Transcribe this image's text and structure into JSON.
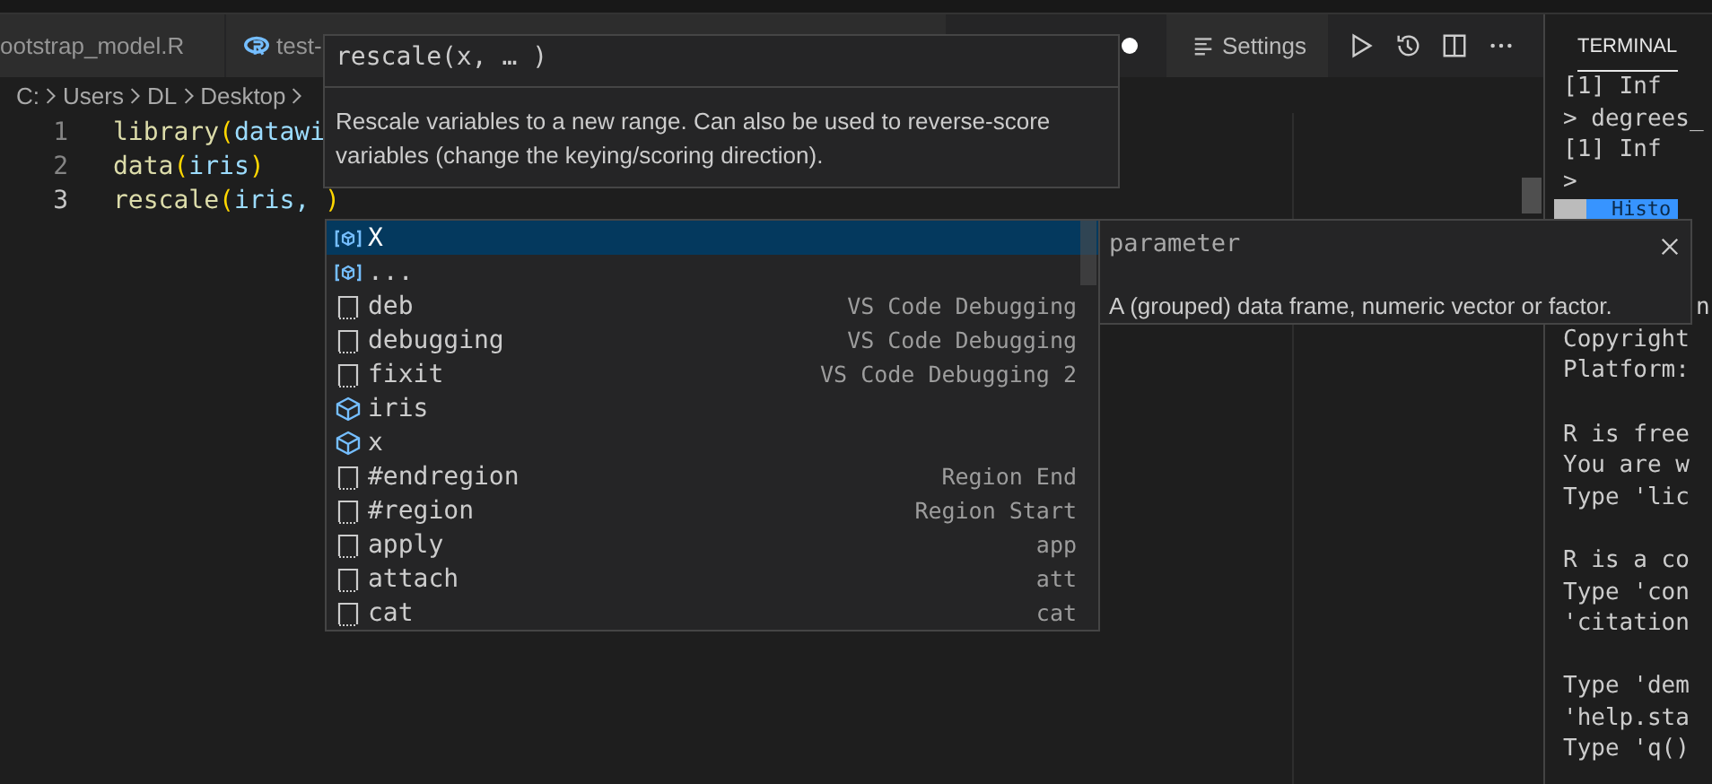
{
  "tabs": [
    {
      "label": "ootstrap_model.R",
      "kind": "file",
      "selected": false,
      "dirty": false
    },
    {
      "label": "test-",
      "kind": "rfile",
      "selected": false,
      "dirty": true
    },
    {
      "label": "Settings",
      "kind": "settings",
      "selected": true,
      "dirty": false
    }
  ],
  "breadcrumbs": [
    "C:",
    "Users",
    "DL",
    "Desktop"
  ],
  "code_lines": [
    {
      "number": "1",
      "tokens": [
        {
          "text": "library",
          "kind": "fn"
        },
        {
          "text": "(",
          "kind": "paren"
        },
        {
          "text": "datawi",
          "kind": "id"
        }
      ]
    },
    {
      "number": "2",
      "tokens": [
        {
          "text": "data",
          "kind": "fn"
        },
        {
          "text": "(",
          "kind": "paren"
        },
        {
          "text": "iris",
          "kind": "id"
        },
        {
          "text": ")",
          "kind": "paren"
        }
      ]
    },
    {
      "number": "3",
      "tokens": [
        {
          "text": "rescale",
          "kind": "fn"
        },
        {
          "text": "(",
          "kind": "paren"
        },
        {
          "text": "iris, ",
          "kind": "id"
        },
        {
          "text": ")",
          "kind": "paren"
        }
      ]
    }
  ],
  "signature_hover": {
    "signature": "rescale(x, … )",
    "description": "Rescale variables to a new range. Can also be used to reverse-score variables (change the keying/scoring direction)."
  },
  "suggestions": [
    {
      "label": "X",
      "kind": "variable",
      "selected": true
    },
    {
      "label": "...",
      "kind": "variable",
      "selected": false
    },
    {
      "label": "deb",
      "detail": "VS Code Debugging",
      "kind": "snippet",
      "selected": false
    },
    {
      "label": "debugging",
      "detail": "VS Code Debugging",
      "kind": "snippet",
      "selected": false
    },
    {
      "label": "fixit",
      "detail": "VS Code Debugging 2",
      "kind": "snippet",
      "selected": false
    },
    {
      "label": "iris",
      "kind": "field",
      "selected": false
    },
    {
      "label": "x",
      "kind": "field",
      "selected": false
    },
    {
      "label": "#endregion",
      "detail": "Region End",
      "kind": "snippet",
      "selected": false
    },
    {
      "label": "#region",
      "detail": "Region Start",
      "kind": "snippet",
      "selected": false
    },
    {
      "label": "apply",
      "detail": "app",
      "kind": "snippet",
      "selected": false
    },
    {
      "label": "attach",
      "detail": "att",
      "kind": "snippet",
      "selected": false
    },
    {
      "label": "cat",
      "detail": "cat",
      "kind": "snippet",
      "selected": false
    }
  ],
  "suggestion_details": {
    "title": "parameter",
    "description": "A (grouped) data frame, numeric vector or factor."
  },
  "terminal": {
    "tab": "TERMINAL",
    "lines": [
      {
        "text": "[1] Inf",
        "kind": "plain"
      },
      {
        "text": "> degrees_",
        "kind": "plain"
      },
      {
        "text": "[1] Inf",
        "kind": "plain"
      },
      {
        "text": ">",
        "kind": "plain"
      },
      {
        "text": "Histo",
        "kind": "badge"
      },
      {
        "kind": "gap"
      },
      {
        "kind": "gap"
      },
      {
        "text": "n",
        "kind": "tail"
      },
      {
        "text": "Copyright",
        "kind": "plain"
      },
      {
        "text": "Platform:",
        "kind": "plain"
      },
      {
        "kind": "gap"
      },
      {
        "text": "R is free",
        "kind": "plain"
      },
      {
        "text": "You are w",
        "kind": "plain"
      },
      {
        "text": "Type 'lic",
        "kind": "plain"
      },
      {
        "kind": "gap"
      },
      {
        "text": "R is a co",
        "kind": "plain"
      },
      {
        "text": "Type 'con",
        "kind": "plain"
      },
      {
        "text": "'citation",
        "kind": "plain"
      },
      {
        "kind": "gap"
      },
      {
        "text": "Type 'dem",
        "kind": "plain"
      },
      {
        "text": "'help.sta",
        "kind": "plain"
      },
      {
        "text": "Type 'q()",
        "kind": "plain"
      }
    ]
  }
}
